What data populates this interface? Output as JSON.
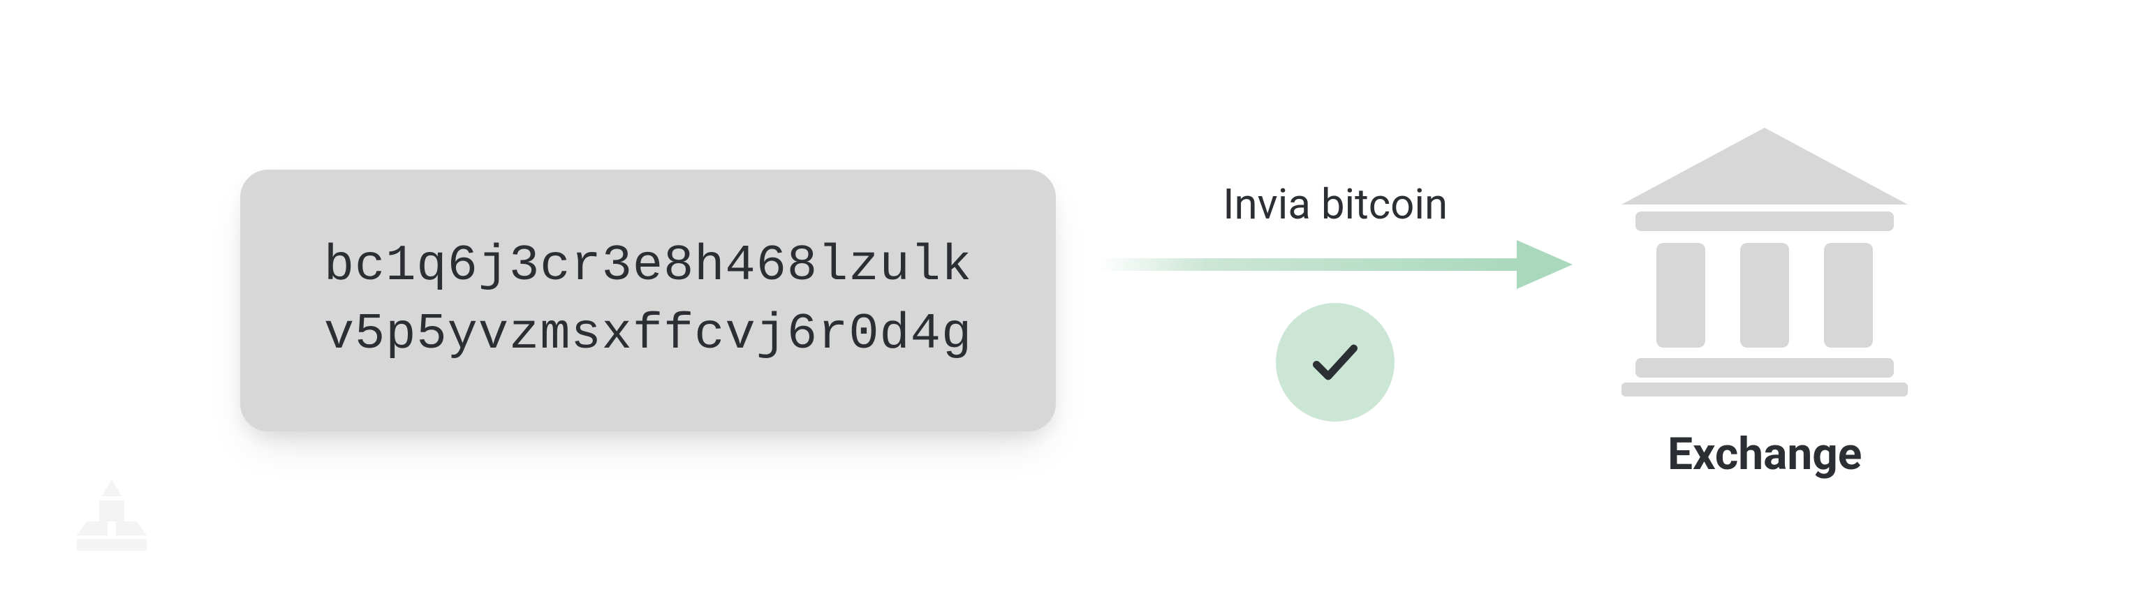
{
  "address": {
    "line1": "bc1q6j3cr3e8h468lzulk",
    "line2": "v5p5yvzmsxffcvj6r0d4g"
  },
  "action": {
    "label": "Invia bitcoin",
    "status": "success"
  },
  "destination": {
    "label": "Exchange"
  },
  "colors": {
    "card_bg": "#d7d7d7",
    "badge_bg": "#cce6d6",
    "arrow_fill": "#cce6d6",
    "text": "#2b2f33",
    "icon_gray": "#d7d7d7"
  }
}
